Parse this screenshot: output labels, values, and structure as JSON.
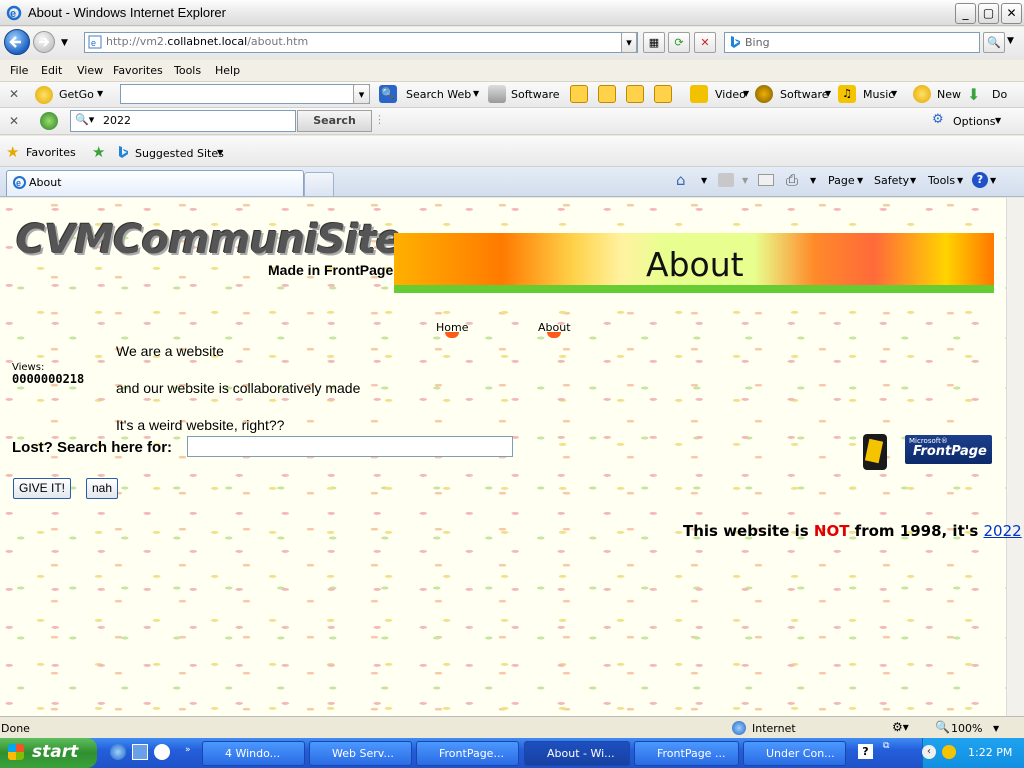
{
  "window": {
    "title": "About - Windows Internet Explorer",
    "minimize": "_",
    "maximize": "▢",
    "close": "✕"
  },
  "address": {
    "url_prefix": "http://vm2.",
    "url_host": "collabnet.local",
    "url_path": "/about.htm",
    "search_placeholder": "Bing"
  },
  "menu": [
    "File",
    "Edit",
    "View",
    "Favorites",
    "Tools",
    "Help"
  ],
  "toolbar1": {
    "getgo": "GetGo",
    "search_web": "Search Web",
    "software": "Software",
    "video": "Video",
    "software2": "Software",
    "music": "Music",
    "new": "New",
    "do": "Do"
  },
  "toolbar2": {
    "query": "2022",
    "search_btn": "Search",
    "options": "Options"
  },
  "favbar": {
    "favorites": "Favorites",
    "suggested": "Suggested Sites"
  },
  "tabs": {
    "active": "About"
  },
  "commandbar": {
    "page": "Page",
    "safety": "Safety",
    "tools": "Tools"
  },
  "site": {
    "logo": "CVMCommuniSite",
    "tagline": "Made in FrontPage",
    "banner_title": "About",
    "nav": [
      "Home",
      "About"
    ],
    "views_label": "Views:",
    "views_count": "0000000218",
    "lines": [
      "We are a website",
      "and our website is collaboratively made",
      "It's a weird website, right??"
    ],
    "search_label": "Lost? Search here for:",
    "submit": "GIVE IT!",
    "reset": "nah",
    "fp_logo_small": "Microsoft®",
    "fp_logo": "FrontPage",
    "footer_pre": "This website is ",
    "footer_not": "NOT",
    "footer_mid": " from 1998, it's ",
    "footer_link": "2022"
  },
  "status": {
    "text": "Done",
    "zone": "Internet",
    "zoom": "100%"
  },
  "taskbar": {
    "start": "start",
    "items": [
      "4 Windo...",
      "Web Serv...",
      "FrontPage...",
      "About - Wi...",
      "FrontPage ...",
      "Under Con..."
    ],
    "clock": "1:22 PM"
  }
}
